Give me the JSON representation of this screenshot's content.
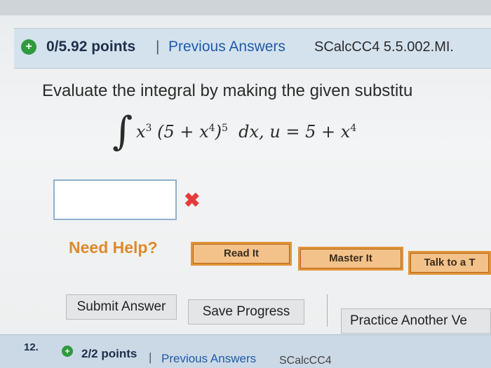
{
  "question": {
    "points": "0/5.92 points",
    "previous_answers": "Previous Answers",
    "course_code": "SCalcCC4 5.5.002.MI.",
    "prompt": "Evaluate the integral by making the given substitu",
    "integral": {
      "sign": "∫",
      "term1": "x",
      "term1_exp": "3",
      "base": "(5 + x",
      "inner_exp": "4",
      "close": ")",
      "outer_exp": "5",
      "diff": "dx,",
      "substitution": "u = 5 + x",
      "sub_exp": "4"
    },
    "answer": {
      "value": "",
      "status_icon": "red-x-icon",
      "status_glyph": "✖"
    }
  },
  "help": {
    "label": "Need Help?",
    "read_it": "Read It",
    "master_it": "Master It",
    "talk_to": "Talk to a T"
  },
  "actions": {
    "submit": "Submit Answer",
    "save": "Save Progress",
    "practice": "Practice Another Ve"
  },
  "next_question": {
    "number": "12.",
    "points": "2/2 points",
    "previous_answers": "Previous Answers",
    "course_code": "SCalcCC4"
  },
  "colors": {
    "header_bg": "#d4e2ee",
    "badge_green": "#2e9b3e",
    "link_blue": "#1f5aa8",
    "help_orange": "#e0892a",
    "error_red": "#e33b3b"
  }
}
